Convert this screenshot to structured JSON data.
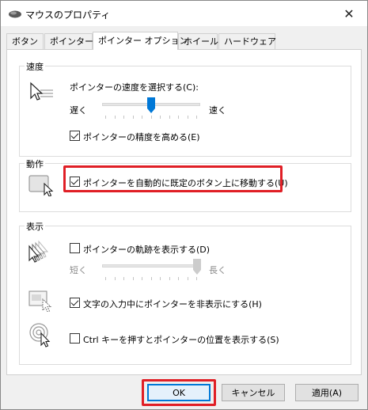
{
  "window": {
    "title": "マウスのプロパティ",
    "close_glyph": "✕"
  },
  "tabs": [
    {
      "label": "ボタン"
    },
    {
      "label": "ポインター"
    },
    {
      "label": "ポインター オプション"
    },
    {
      "label": "ホイール"
    },
    {
      "label": "ハードウェア"
    }
  ],
  "active_tab": "ポインター オプション",
  "speed": {
    "group_label": "速度",
    "select_label": "ポインターの速度を選択する(C):",
    "slow": "遅く",
    "fast": "速く",
    "slider_value": 0.5,
    "precision_label": "ポインターの精度を高める(E)",
    "precision_checked": true
  },
  "motion": {
    "group_label": "動作",
    "snap_label": "ポインターを自動的に既定のボタン上に移動する(U)",
    "snap_checked": true
  },
  "visibility": {
    "group_label": "表示",
    "trails_label": "ポインターの軌跡を表示する(D)",
    "trails_checked": false,
    "short": "短く",
    "long": "長く",
    "trails_slider_value": 1.0,
    "hide_typing_label": "文字の入力中にポインターを非表示にする(H)",
    "hide_typing_checked": true,
    "ctrl_label": "Ctrl キーを押すとポインターの位置を表示する(S)",
    "ctrl_checked": false
  },
  "buttons": {
    "ok": "OK",
    "cancel": "キャンセル",
    "apply": "適用(A)"
  },
  "colors": {
    "highlight": "#e01f26",
    "accent": "#0078d7",
    "slider_thumb": "#0078d7"
  }
}
